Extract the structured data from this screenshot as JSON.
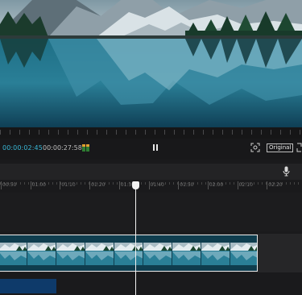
{
  "preview": {
    "image": "mountain-lake-landscape"
  },
  "player": {
    "current_time": "00:00:02:45",
    "total_time": "00:00:27:58",
    "zoom_mode_label": "Original"
  },
  "timeline": {
    "ruler_labels": [
      "00:50",
      "01:00",
      "01:10",
      "01:20",
      "01:30",
      "01:40",
      "01:50",
      "02:00",
      "02:10",
      "02:20"
    ],
    "video_clip_thumbnail_count": 9
  },
  "colors": {
    "accent": "#39b7d6",
    "background": "#1c1c1e",
    "playhead": "#f2f2f2",
    "audio_clip": "#0e3a6a"
  }
}
